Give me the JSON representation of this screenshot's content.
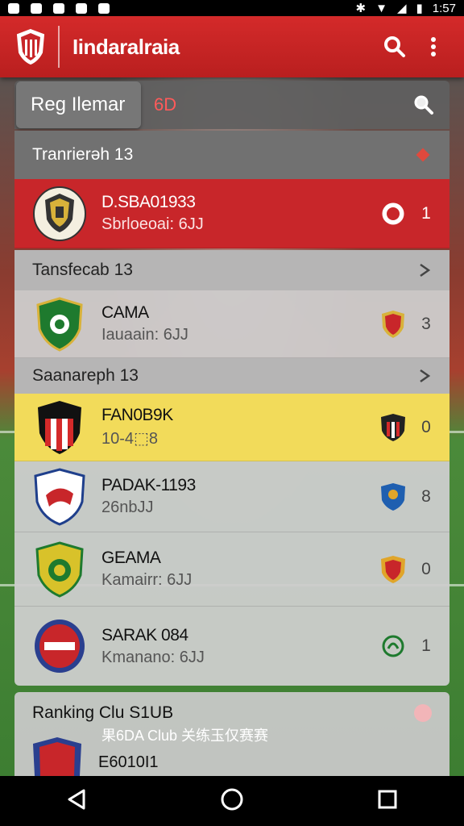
{
  "status_bar": {
    "time": "1:57"
  },
  "app_bar": {
    "title": "Iindaralraia"
  },
  "search": {
    "value": "Reg Ilemar",
    "count": "6D"
  },
  "sections": [
    {
      "title": "Tranrierəh 13",
      "rows": [
        {
          "name": "D.SBA01933",
          "sub": "Sbrloeoai: 6JJ",
          "count": "1"
        }
      ]
    },
    {
      "title": "Tansfecab 13",
      "rows": [
        {
          "name": "CAMA",
          "sub": "Iauaain: 6JJ",
          "count": "3"
        }
      ]
    },
    {
      "title": "Saanareph 13",
      "rows": [
        {
          "name": "FAN0B9K",
          "sub": "10-4⬚8",
          "count": "0"
        },
        {
          "name": "PADAK-1193",
          "sub": "26nbJJ",
          "count": "8"
        },
        {
          "name": "GEAMA",
          "sub": "Kamairr: 6JJ",
          "count": "0"
        },
        {
          "name": "SARAK 084",
          "sub": "Kmanano: 6JJ",
          "count": "1"
        }
      ]
    }
  ],
  "ranking": {
    "title": "Ranking Clu S1UB",
    "subtitle": "果6DA Club 关练玉仅赛赛",
    "row_name": "E6010I1"
  },
  "colors": {
    "accent_red": "#c8262a",
    "highlight_yellow": "#f2db5a"
  }
}
